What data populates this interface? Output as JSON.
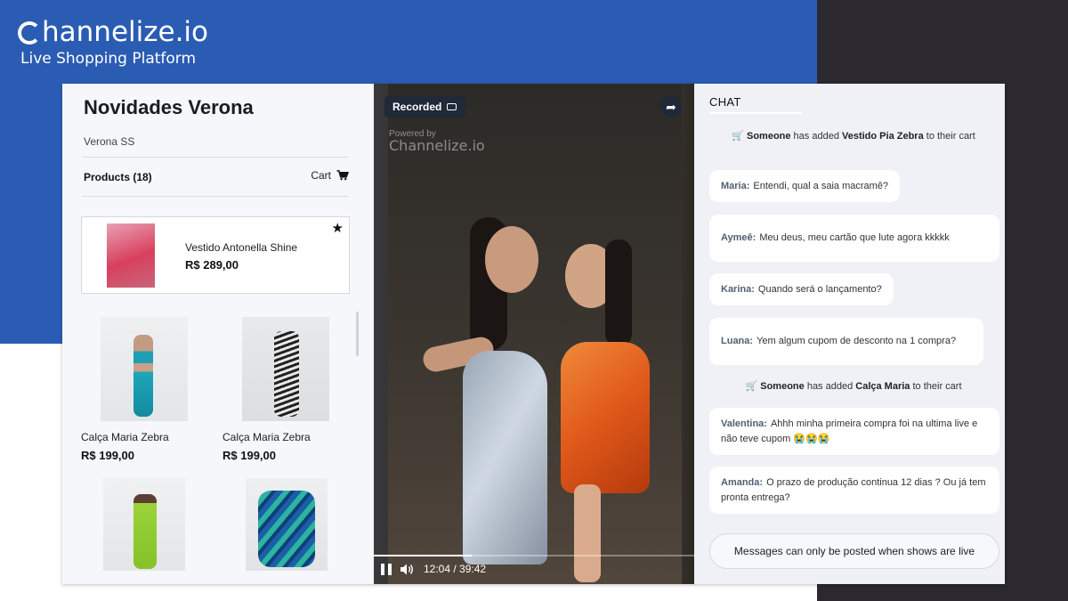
{
  "brand": {
    "name": "hannelize.io",
    "tagline": "Live Shopping Platform"
  },
  "colors": {
    "brand_blue": "#2b5cb3",
    "dark_panel": "#2b2830",
    "card_bg": "#f6f7fa"
  },
  "store": {
    "title": "Novidades Verona",
    "subtitle": "Verona SS",
    "products_label": "Products (18)",
    "cart_label": "Cart",
    "cart_icon": "cart-icon"
  },
  "featured": {
    "name": "Vestido Antonella Shine",
    "price": "R$ 289,00",
    "icon": "star-icon"
  },
  "products": [
    {
      "name": "Calça Maria Zebra",
      "price": "R$ 199,00"
    },
    {
      "name": "Calça Maria Zebra",
      "price": "R$ 199,00"
    },
    {
      "name": "",
      "price": ""
    },
    {
      "name": "",
      "price": ""
    }
  ],
  "video": {
    "badge": "Recorded",
    "powered_by": "Powered by",
    "powered_name": "Channelize.io",
    "time": "12:04 / 39:42",
    "progress_fraction": 0.305
  },
  "chat": {
    "title": "CHAT",
    "messages": [
      {
        "type": "system",
        "who": "Someone",
        "action": " has added ",
        "item": "Vestido Pia Zebra",
        "tail": " to their cart"
      },
      {
        "type": "user",
        "author": "Maria:",
        "text": "Entendi, qual a saia macramê?"
      },
      {
        "type": "user",
        "author": "Aymeê:",
        "text": "Meu deus, meu cartão que lute agora kkkkk"
      },
      {
        "type": "user",
        "author": "Karina:",
        "text": "Quando será o lançamento?"
      },
      {
        "type": "user",
        "author": "Luana:",
        "text": "Yem algum cupom de desconto na 1 compra?"
      },
      {
        "type": "system",
        "who": "Someone",
        "action": " has added ",
        "item": "Calça Maria",
        "tail": " to their cart"
      },
      {
        "type": "user",
        "author": "Valentina:",
        "text": "Ahhh minha primeira compra foi na ultima live e não teve cupom 😭😭😭"
      },
      {
        "type": "user",
        "author": "Amanda:",
        "text": "O prazo de produção continua 12 dias ? Ou já tem pronta entrega?"
      }
    ],
    "input_notice": "Messages can only be posted when shows are live"
  }
}
